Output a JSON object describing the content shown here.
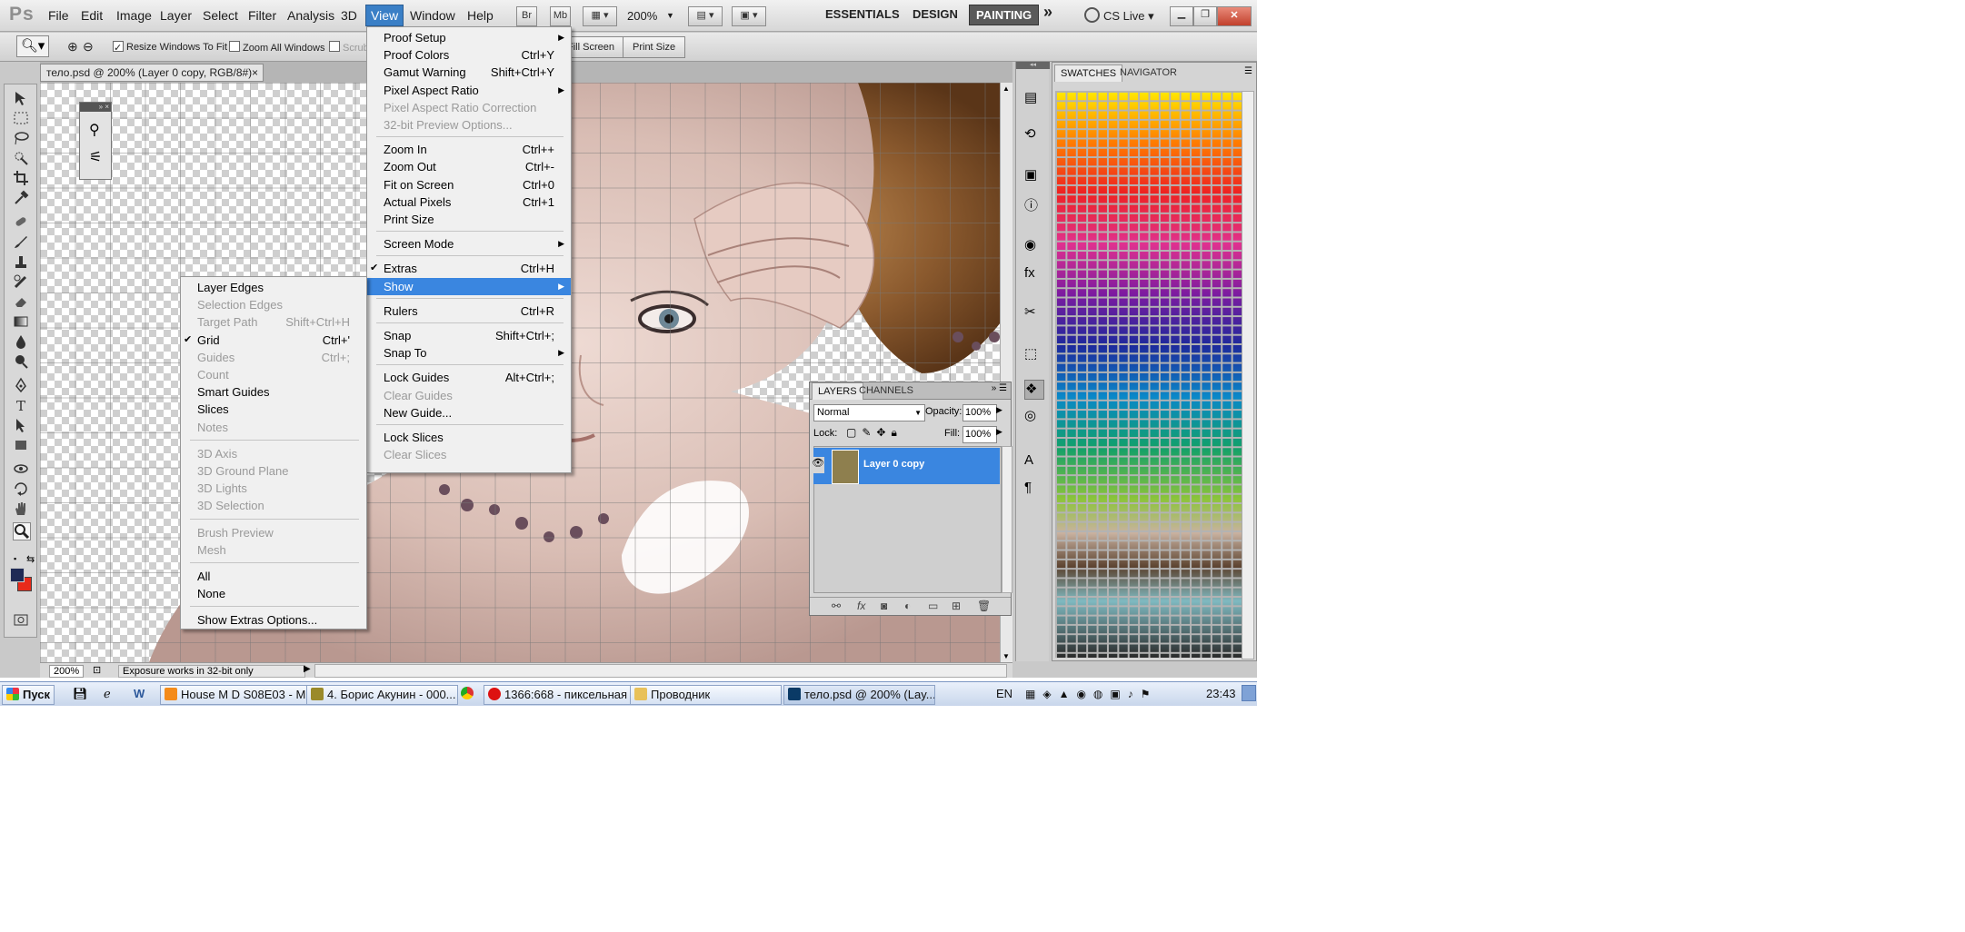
{
  "app": {
    "logo": "Ps",
    "menus": [
      "File",
      "Edit",
      "Image",
      "Layer",
      "Select",
      "Filter",
      "Analysis",
      "3D",
      "View",
      "Window",
      "Help"
    ],
    "active_menu": "View",
    "bridge_label": "Br",
    "minibridge_label": "Mb",
    "zoom_value": "200%",
    "workspaces": [
      "ESSENTIALS",
      "DESIGN",
      "PAINTING"
    ],
    "active_workspace": "PAINTING",
    "more_label": "»",
    "cslive_label": "CS Live"
  },
  "options": {
    "resize_windows": "Resize Windows To Fit",
    "zoom_all": "Zoom All Windows",
    "scrubby": "Scrub",
    "fill_screen": "Fill Screen",
    "print_size": "Print Size"
  },
  "document": {
    "tab_title": "тело.psd @ 200% (Layer 0 copy, RGB/8#)",
    "close_glyph": "×",
    "status_zoom": "200%",
    "status_text": "Exposure works in 32-bit only"
  },
  "view_menu": {
    "items": [
      {
        "label": "Proof Setup",
        "shortcut": "",
        "submenu": true,
        "disabled": false
      },
      {
        "label": "Proof Colors",
        "shortcut": "Ctrl+Y",
        "submenu": false,
        "disabled": false
      },
      {
        "label": "Gamut Warning",
        "shortcut": "Shift+Ctrl+Y",
        "submenu": false,
        "disabled": false
      },
      {
        "label": "Pixel Aspect Ratio",
        "shortcut": "",
        "submenu": true,
        "disabled": false
      },
      {
        "label": "Pixel Aspect Ratio Correction",
        "shortcut": "",
        "submenu": false,
        "disabled": true
      },
      {
        "label": "32-bit Preview Options...",
        "shortcut": "",
        "submenu": false,
        "disabled": true
      },
      {
        "label": "Zoom In",
        "shortcut": "Ctrl++",
        "submenu": false,
        "disabled": false
      },
      {
        "label": "Zoom Out",
        "shortcut": "Ctrl+-",
        "submenu": false,
        "disabled": false
      },
      {
        "label": "Fit on Screen",
        "shortcut": "Ctrl+0",
        "submenu": false,
        "disabled": false
      },
      {
        "label": "Actual Pixels",
        "shortcut": "Ctrl+1",
        "submenu": false,
        "disabled": false
      },
      {
        "label": "Print Size",
        "shortcut": "",
        "submenu": false,
        "disabled": false
      },
      {
        "label": "Screen Mode",
        "shortcut": "",
        "submenu": true,
        "disabled": false
      },
      {
        "label": "Extras",
        "shortcut": "Ctrl+H",
        "submenu": false,
        "disabled": false,
        "checked": true
      },
      {
        "label": "Show",
        "shortcut": "",
        "submenu": true,
        "disabled": false,
        "highlighted": true
      },
      {
        "label": "Rulers",
        "shortcut": "Ctrl+R",
        "submenu": false,
        "disabled": false
      },
      {
        "label": "Snap",
        "shortcut": "Shift+Ctrl+;",
        "submenu": false,
        "disabled": false
      },
      {
        "label": "Snap To",
        "shortcut": "",
        "submenu": true,
        "disabled": false
      },
      {
        "label": "Lock Guides",
        "shortcut": "Alt+Ctrl+;",
        "submenu": false,
        "disabled": false
      },
      {
        "label": "Clear Guides",
        "shortcut": "",
        "submenu": false,
        "disabled": true
      },
      {
        "label": "New Guide...",
        "shortcut": "",
        "submenu": false,
        "disabled": false
      },
      {
        "label": "Lock Slices",
        "shortcut": "",
        "submenu": false,
        "disabled": false
      },
      {
        "label": "Clear Slices",
        "shortcut": "",
        "submenu": false,
        "disabled": true
      }
    ]
  },
  "show_menu": {
    "items": [
      {
        "label": "Layer Edges",
        "shortcut": "",
        "disabled": false
      },
      {
        "label": "Selection Edges",
        "shortcut": "",
        "disabled": true
      },
      {
        "label": "Target Path",
        "shortcut": "Shift+Ctrl+H",
        "disabled": true
      },
      {
        "label": "Grid",
        "shortcut": "Ctrl+'",
        "disabled": false,
        "checked": true
      },
      {
        "label": "Guides",
        "shortcut": "Ctrl+;",
        "disabled": true
      },
      {
        "label": "Count",
        "shortcut": "",
        "disabled": true
      },
      {
        "label": "Smart Guides",
        "shortcut": "",
        "disabled": false
      },
      {
        "label": "Slices",
        "shortcut": "",
        "disabled": false
      },
      {
        "label": "Notes",
        "shortcut": "",
        "disabled": true
      },
      {
        "label": "3D Axis",
        "shortcut": "",
        "disabled": true
      },
      {
        "label": "3D Ground Plane",
        "shortcut": "",
        "disabled": true
      },
      {
        "label": "3D Lights",
        "shortcut": "",
        "disabled": true
      },
      {
        "label": "3D Selection",
        "shortcut": "",
        "disabled": true
      },
      {
        "label": "Brush Preview",
        "shortcut": "",
        "disabled": true
      },
      {
        "label": "Mesh",
        "shortcut": "",
        "disabled": true
      },
      {
        "label": "All",
        "shortcut": "",
        "disabled": false
      },
      {
        "label": "None",
        "shortcut": "",
        "disabled": false
      },
      {
        "label": "Show Extras Options...",
        "shortcut": "",
        "disabled": false
      }
    ]
  },
  "swatches": {
    "tab_swatches": "SWATCHES",
    "tab_navigator": "NAVIGATOR"
  },
  "layers": {
    "tab_layers": "LAYERS",
    "tab_channels": "CHANNELS",
    "blend_mode": "Normal",
    "opacity_label": "Opacity:",
    "opacity_value": "100%",
    "lock_label": "Lock:",
    "fill_label": "Fill:",
    "fill_value": "100%",
    "layer_name": "Layer 0 copy",
    "fx_label": "fx"
  },
  "colors": {
    "menu_highlight": "#3a86e0",
    "foreground": "#1f2a55",
    "background": "#e82a1a"
  },
  "taskbar": {
    "start": "Пуск",
    "items": [
      "House M D S08E03 - M...",
      "4. Борис Акунин - 000...",
      "1366:668 - пиксельная ...",
      "Проводник",
      "тело.psd @ 200% (Lay..."
    ],
    "lang": "EN",
    "clock": "23:43"
  }
}
